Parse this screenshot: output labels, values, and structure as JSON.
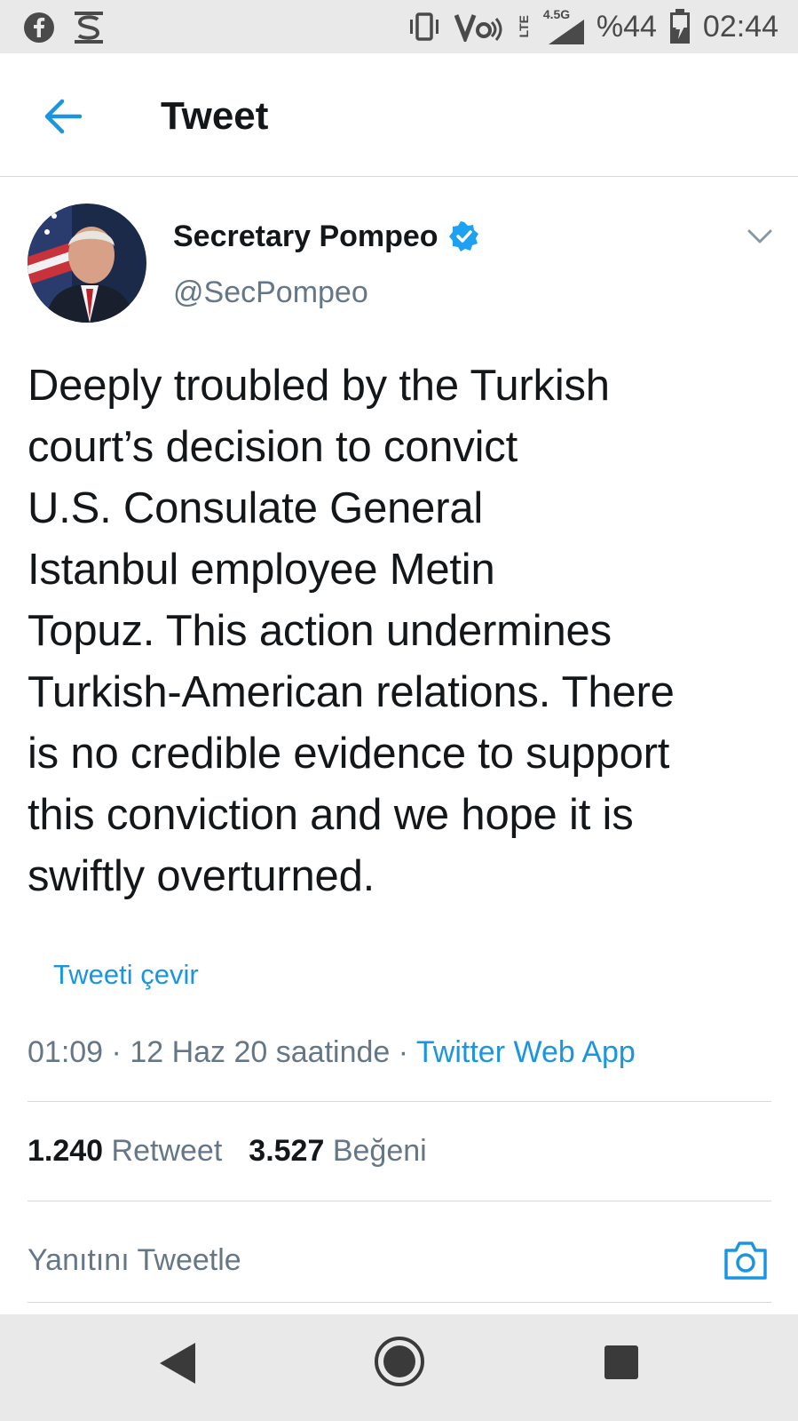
{
  "status_bar": {
    "lte_label": "LTE",
    "network_label": "4.5G",
    "battery_text": "%44",
    "time": "02:44",
    "icons": [
      "facebook-icon",
      "s-app-icon",
      "vibrate-icon",
      "volte-icon",
      "signal-icon",
      "battery-charging-icon"
    ]
  },
  "header": {
    "title": "Tweet"
  },
  "tweet": {
    "display_name": "Secretary Pompeo",
    "handle": "@SecPompeo",
    "verified": true,
    "text": "Deeply troubled by the Turkish\ncourt’s decision to convict\nU.S. Consulate General\nIstanbul employee Metin\nTopuz. This action undermines\nTurkish-American relations. There\nis no credible evidence to support\nthis conviction and we hope it is\nswiftly overturned.",
    "translate_label": "Tweeti çevir",
    "time": "01:09",
    "separator": " · ",
    "date": "12 Haz 20 saatinde",
    "source": "Twitter Web App"
  },
  "stats": {
    "retweet_count": "1.240",
    "retweet_label": "Retweet",
    "like_count": "3.527",
    "like_label": "Beğeni"
  },
  "reply": {
    "placeholder": "Yanıtını Tweetle"
  },
  "colors": {
    "accent": "#1b95e0",
    "secondary_text": "#657786",
    "primary_text": "#14171a",
    "divider": "#d6d9db",
    "system_bar": "#e9e9e9"
  }
}
